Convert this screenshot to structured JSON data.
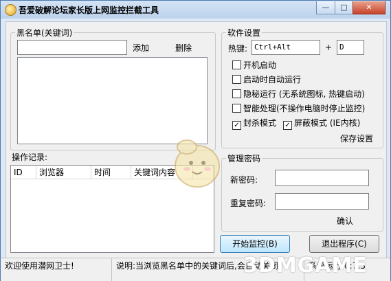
{
  "window": {
    "title": "吾爱破解论坛家长版上网监控拦截工具",
    "minimize_glyph": "—",
    "maximize_glyph": "□",
    "close_glyph": "✕"
  },
  "blacklist": {
    "group_label": "黑名单(关键词)",
    "keyword_value": "",
    "add_label": "添加",
    "delete_label": "删除",
    "items": []
  },
  "settings": {
    "group_label": "软件设置",
    "hotkey_label": "热键:",
    "hotkey_modifier": "Ctrl+Alt",
    "plus": "+",
    "hotkey_key": "D",
    "options": [
      {
        "label": "开机启动",
        "checked": false
      },
      {
        "label": "启动时自动运行",
        "checked": false
      },
      {
        "label": "隐秘运行 (无系统图标, 热键启动)",
        "checked": false
      },
      {
        "label": "智能处理(不操作电脑时停止监控)",
        "checked": false
      },
      {
        "label": "封杀模式",
        "checked": true
      },
      {
        "label": "屏蔽模式 (IE内核)",
        "checked": true
      }
    ],
    "check_mark": "✓",
    "save_label": "保存设置"
  },
  "log": {
    "label": "操作记录:",
    "columns": [
      "ID",
      "浏览器",
      "时间",
      "关键词内容"
    ],
    "rows": []
  },
  "password": {
    "group_label": "管理密码",
    "new_label": "新密码:",
    "repeat_label": "重复密码:",
    "confirm_label": "确认"
  },
  "actions": {
    "start_label": "开始监控(B)",
    "exit_label": "退出程序(C)"
  },
  "statusbar": {
    "welcome": "欢迎使用潜网卫士!",
    "note": "说明:当浏览黑名单中的关键词后,会自动关闭",
    "runtime": "系统运行:0:7:3"
  },
  "watermark": "3DMGAME",
  "colors": {
    "accent_button": "#bee6fd",
    "title_gradient": "#bcd2ec",
    "close_button": "#c7432a"
  }
}
